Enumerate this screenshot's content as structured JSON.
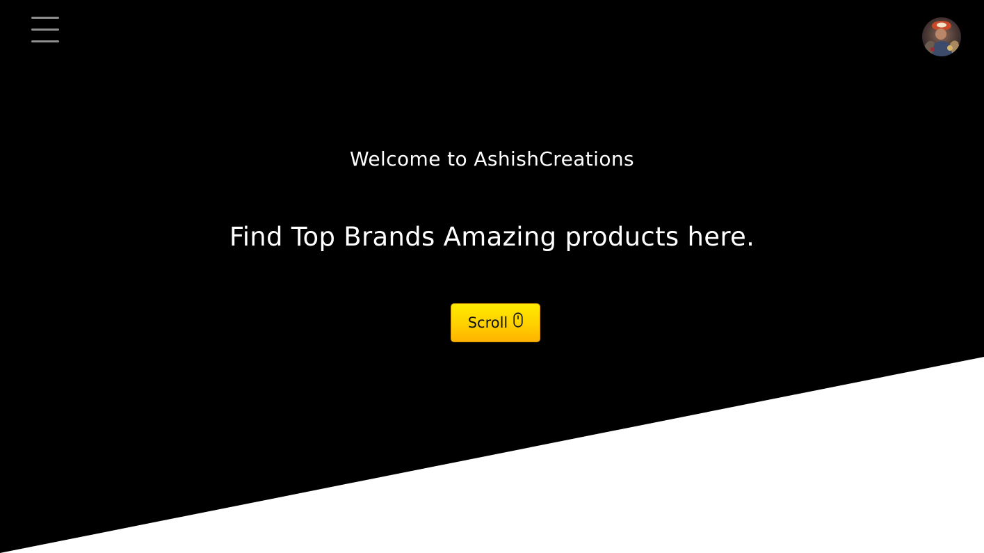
{
  "header": {
    "menu_icon": "hamburger-menu-icon",
    "avatar_icon": "profile-avatar"
  },
  "hero": {
    "welcome_text": "Welcome to AshishCreations",
    "tagline": "Find Top Brands Amazing products here.",
    "scroll_button": {
      "label": "Scroll",
      "icon": "mouse-icon"
    }
  },
  "colors": {
    "background_dark": "#000000",
    "background_light": "#ffffff",
    "button_accent": "#ffd000",
    "menu_bars": "#8f8f8f"
  }
}
